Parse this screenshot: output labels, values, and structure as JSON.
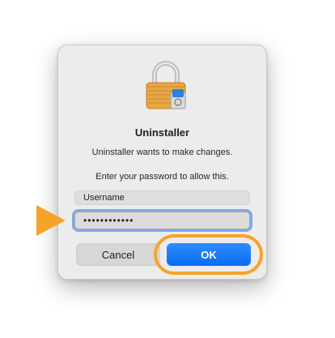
{
  "dialog": {
    "icon": "lock-icon",
    "title": "Uninstaller",
    "message": "Uninstaller wants to make changes.",
    "prompt": "Enter your password to allow this.",
    "username_value": "Username",
    "password_value": "••••••••••••",
    "cancel_label": "Cancel",
    "ok_label": "OK"
  },
  "annotations": {
    "arrow_icon": "pointer-arrow-icon",
    "highlight_color": "#f5a42a"
  },
  "colors": {
    "accent": "#0a6cf5",
    "focus_ring": "#7ea9e6"
  }
}
